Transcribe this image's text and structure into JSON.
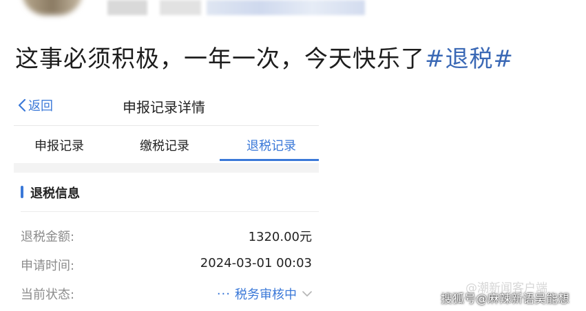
{
  "post": {
    "text": "这事必须积极，一年一次，今天快乐了",
    "hashtag": "#退税#"
  },
  "app": {
    "back_label": "返回",
    "title": "申报记录详情",
    "tabs": [
      {
        "label": "申报记录",
        "active": false
      },
      {
        "label": "缴税记录",
        "active": false
      },
      {
        "label": "退税记录",
        "active": true
      }
    ],
    "section_title": "退税信息",
    "rows": [
      {
        "label": "退税金额:",
        "value": "1320.00元"
      },
      {
        "label": "申请时间:",
        "value": "2024-03-01 00:03"
      },
      {
        "label": "当前状态:",
        "value": "税务审核中"
      }
    ],
    "status_dots": "···"
  },
  "watermark": {
    "faint": "@潮新闻客户端",
    "main": "搜狐号@麻辣新语吴能想"
  },
  "colors": {
    "accent": "#3a78d8",
    "hashtag": "#3a68b5",
    "label_gray": "#8c8c8c"
  },
  "icons": {
    "back": "chevron-left-icon",
    "status_expand": "chevron-down-icon"
  }
}
